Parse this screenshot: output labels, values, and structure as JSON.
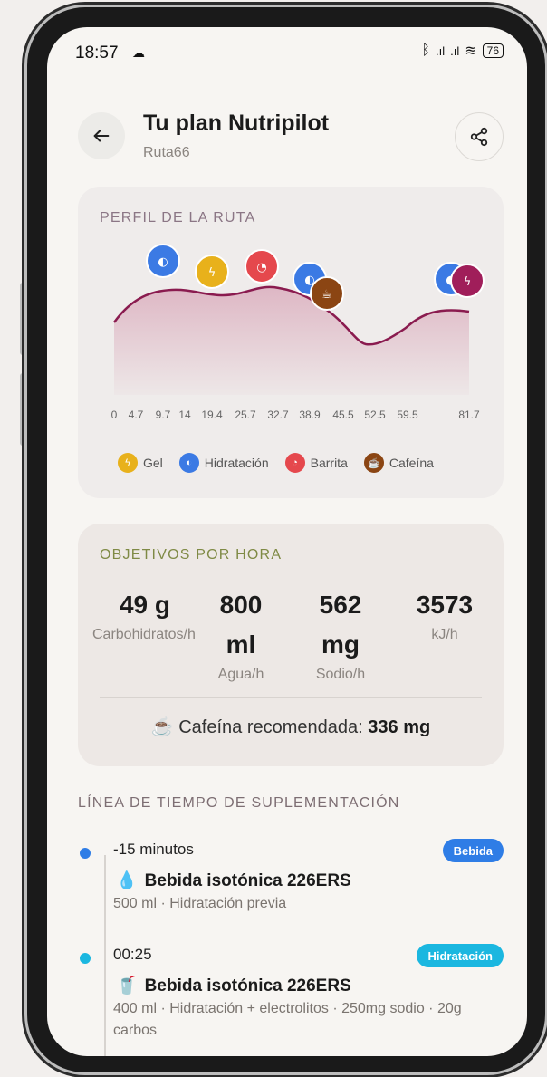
{
  "status": {
    "time": "18:57",
    "battery": "76"
  },
  "header": {
    "title": "Tu plan Nutripilot",
    "subtitle": "Ruta66"
  },
  "route": {
    "label": "PERFIL DE LA RUTA",
    "legend": [
      {
        "label": "Gel",
        "color": "#e8b11b",
        "icon": "lightning-icon"
      },
      {
        "label": "Hidratación",
        "color": "#3b7ae4",
        "icon": "drop-icon"
      },
      {
        "label": "Barrita",
        "color": "#e5484d",
        "icon": "bar-icon"
      },
      {
        "label": "Cafeína",
        "color": "#8b4513",
        "icon": "coffee-icon"
      }
    ]
  },
  "chart_data": {
    "type": "area",
    "x_ticks": [
      "0",
      "4.7",
      "9.7",
      "14",
      "19.4",
      "25.7",
      "32.7",
      "38.9",
      "45.5",
      "52.5",
      "59.5",
      "81.7"
    ],
    "line_color": "#8a1b4f",
    "fill_color": "#dcb1c0",
    "markers": [
      {
        "km": 9.7,
        "type": "Hidratación",
        "color": "#3b7ae4"
      },
      {
        "km": 19.4,
        "type": "Gel",
        "color": "#e8b11b"
      },
      {
        "km": 29.5,
        "type": "Barrita",
        "color": "#e5484d"
      },
      {
        "km": 38.9,
        "type": "Hidratación",
        "color": "#3b7ae4"
      },
      {
        "km": 41.0,
        "type": "Cafeína",
        "color": "#8b4513"
      },
      {
        "km": 76.0,
        "type": "Hidratación",
        "color": "#3b7ae4"
      },
      {
        "km": 79.0,
        "type": "Gel",
        "color": "#a01e5a"
      }
    ]
  },
  "goals": {
    "label": "OBJETIVOS POR HORA",
    "metrics": [
      {
        "value": "49 g",
        "label": "Carbohidratos/h"
      },
      {
        "value": "800 ml",
        "label": "Agua/h"
      },
      {
        "value": "562 mg",
        "label": "Sodio/h"
      },
      {
        "value": "3573",
        "label": "kJ/h"
      }
    ],
    "caffeine_prefix": "☕ Cafeína recomendada:",
    "caffeine_value": "336 mg"
  },
  "timeline": {
    "title": "LÍNEA DE TIEMPO DE SUPLEMENTACIÓN",
    "items": [
      {
        "time": "-15 minutos",
        "badge": "Bebida",
        "badge_color": "#2f7de6",
        "dot_color": "#2f7de6",
        "emoji": "💧",
        "name": "Bebida isotónica 226ERS",
        "desc": "500 ml · Hidratación previa"
      },
      {
        "time": "00:25",
        "badge": "Hidratación",
        "badge_color": "#1bb7e0",
        "dot_color": "#1bb7e0",
        "emoji": "🥤",
        "name": "Bebida isotónica 226ERS",
        "desc": "400 ml · Hidratación + electrolitos · 250mg sodio · 20g carbos"
      }
    ]
  }
}
